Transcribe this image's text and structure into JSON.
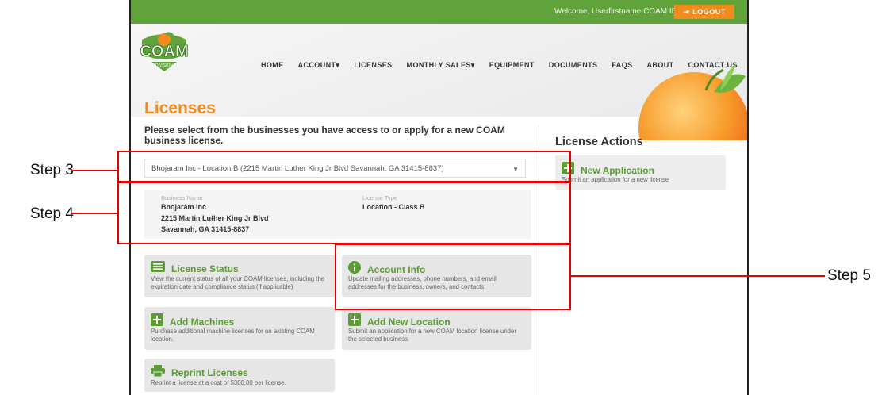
{
  "header": {
    "welcome": "Welcome, Userfirstname  COAM ID: 732",
    "logout_label": "LOGOUT",
    "logo_text": "COAM",
    "logo_subtext": "DIVISION"
  },
  "nav": {
    "items": [
      {
        "label": "HOME"
      },
      {
        "label": "ACCOUNT▾"
      },
      {
        "label": "LICENSES"
      },
      {
        "label": "MONTHLY SALES▾"
      },
      {
        "label": "EQUIPMENT"
      },
      {
        "label": "DOCUMENTS"
      },
      {
        "label": "FAQS"
      },
      {
        "label": "ABOUT"
      },
      {
        "label": "CONTACT US"
      }
    ]
  },
  "page": {
    "title": "Licenses",
    "prompt": "Please select from the businesses you have access to or apply for a new COAM business license."
  },
  "business_select": {
    "value": "Bhojaram Inc - Location B (2215 Martin Luther King Jr Blvd Savannah, GA 31415-8837)"
  },
  "business_info": {
    "name_label": "Business Name",
    "name": "Bhojaram Inc",
    "address_line1": "2215 Martin Luther King Jr Blvd",
    "address_line2": "Savannah, GA 31415-8837",
    "license_type_label": "License Type",
    "license_type": "Location - Class B"
  },
  "cards": {
    "license_status": {
      "title": "License Status",
      "desc": "View the current status of all your COAM licenses, including the expiration date and compliance status (if applicable)",
      "icon": "list-icon"
    },
    "account_info": {
      "title": "Account Info",
      "desc": "Update mailing addresses, phone numbers, and email addresses for the business, owners, and contacts.",
      "icon": "info-icon"
    },
    "add_machines": {
      "title": "Add Machines",
      "desc": "Purchase additional machine licenses for an existing COAM location.",
      "icon": "plus-icon"
    },
    "add_location": {
      "title": "Add New Location",
      "desc": "Submit an application for a new COAM location license under the selected business.",
      "icon": "plus-icon"
    },
    "reprint": {
      "title": "Reprint Licenses",
      "desc": "Reprint a license at a cost of $300.00 per license.",
      "icon": "printer-icon"
    }
  },
  "license_actions": {
    "title": "License Actions",
    "new_app_title": "New Application",
    "new_app_desc": "Submit an application for a new license"
  },
  "annotations": {
    "step3": "Step 3",
    "step4": "Step 4",
    "step5": "Step 5",
    "color": "#e60000"
  },
  "colors": {
    "green": "#5fa33a",
    "orange": "#f28a1d",
    "logout": "#f08c1b"
  }
}
